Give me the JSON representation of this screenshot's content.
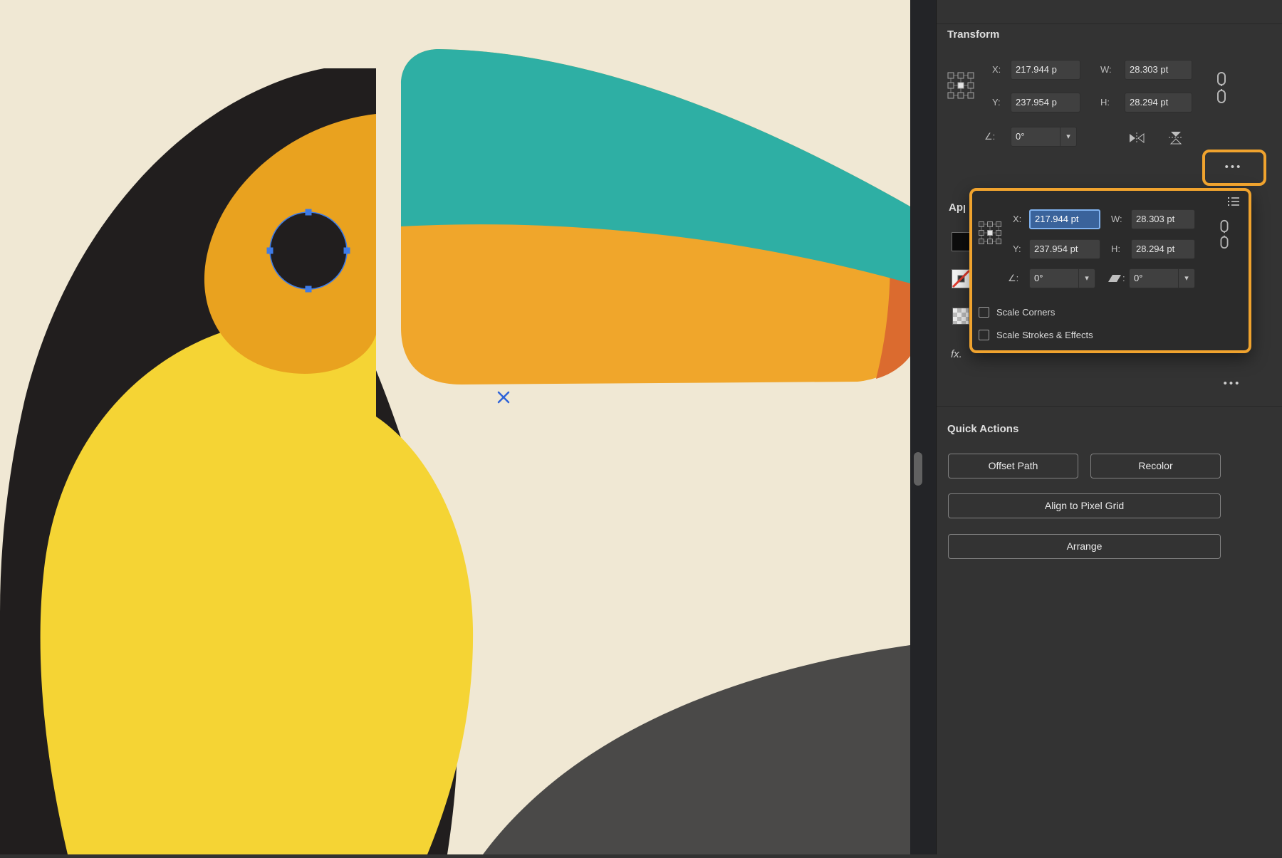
{
  "colors": {
    "accent_highlight": "#F0A32E",
    "selection_blue": "#3D7BE8",
    "marker_blue": "#2E63D8",
    "canvas_background": "#F0E8D4",
    "head_black": "#211E1E",
    "eye_patch_orange": "#E9A21F",
    "cheek_yellow": "#F5D434",
    "beak_teal": "#2EAFA4",
    "beak_orange": "#F0A62B",
    "beak_tip_orange": "#DB6B2F",
    "body_gray": "#4A4948"
  },
  "transform_panel": {
    "title": "Transform",
    "x_label": "X:",
    "x_value": "217.944 p",
    "y_label": "Y:",
    "y_value": "237.954 p",
    "w_label": "W:",
    "w_value": "28.303 pt",
    "h_label": "H:",
    "h_value": "28.294 pt",
    "angle_label": "∠:",
    "angle_value": "0°",
    "chevron": "▾",
    "more_dots": "•••"
  },
  "transform_popup": {
    "x_label": "X:",
    "x_value": "217.944 pt",
    "y_label": "Y:",
    "y_value": "237.954 pt",
    "w_label": "W:",
    "w_value": "28.303 pt",
    "h_label": "H:",
    "h_value": "28.294 pt",
    "rotate_label": "∠:",
    "rotate_value": "0°",
    "shear_colon": ":",
    "shear_value": "0°",
    "chevron": "▾",
    "scale_corners": "Scale Corners",
    "scale_strokes": "Scale Strokes & Effects"
  },
  "appearance": {
    "title": "Appearance",
    "fx": "fx.",
    "more_dots": "•••"
  },
  "quick_actions": {
    "title": "Quick Actions",
    "offset_path": "Offset Path",
    "recolor": "Recolor",
    "align_to_pixel_grid": "Align to Pixel Grid",
    "arrange": "Arrange"
  }
}
